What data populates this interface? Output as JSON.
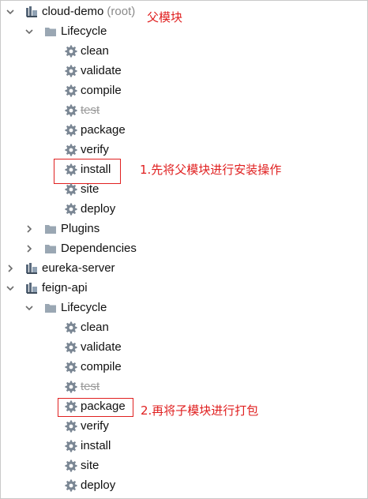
{
  "tree": {
    "root1": {
      "name": "cloud-demo",
      "suffix": "(root)"
    },
    "lifecycle1": "Lifecycle",
    "phases1": [
      "clean",
      "validate",
      "compile",
      "test",
      "package",
      "verify",
      "install",
      "site",
      "deploy"
    ],
    "plugins": "Plugins",
    "dependencies": "Dependencies",
    "eureka": "eureka-server",
    "root2": {
      "name": "feign-api"
    },
    "lifecycle2": "Lifecycle",
    "phases2": [
      "clean",
      "validate",
      "compile",
      "test",
      "package",
      "verify",
      "install",
      "site",
      "deploy"
    ]
  },
  "annotations": {
    "parent_module": "父模块",
    "step1": "1.先将父模块进行安装操作",
    "step2": "2.再将子模块进行打包"
  },
  "colors": {
    "annotation": "#e02020",
    "gear": "#7b8794",
    "folder": "#9aa7b3"
  }
}
